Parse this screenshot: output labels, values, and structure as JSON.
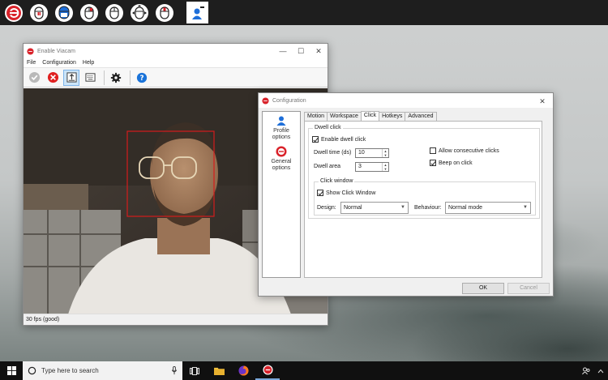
{
  "main_window": {
    "title": "Enable Viacam",
    "menu": [
      "File",
      "Configuration",
      "Help"
    ],
    "status": "30 fps (good)"
  },
  "config_window": {
    "title": "Configuration",
    "sidebar": [
      {
        "label": "Profile options",
        "line1": "Profile",
        "line2": "options"
      },
      {
        "label": "General options",
        "line1": "General",
        "line2": "options"
      }
    ],
    "tabs": [
      "Motion",
      "Workspace",
      "Click",
      "Hotkeys",
      "Advanced"
    ],
    "selected_tab": "Click",
    "dwell": {
      "group_label": "Dwell click",
      "enable_label": "Enable dwell click",
      "enable_checked": true,
      "time_label": "Dwell time (ds)",
      "time_value": "10",
      "area_label": "Dwell area",
      "area_value": "3",
      "consecutive_label": "Allow consecutive clicks",
      "consecutive_checked": false,
      "beep_label": "Beep on click",
      "beep_checked": true
    },
    "click_window": {
      "group_label": "Click window",
      "show_label": "Show Click Window",
      "show_checked": true,
      "design_label": "Design:",
      "design_value": "Normal",
      "behaviour_label": "Behaviour:",
      "behaviour_value": "Normal mode"
    },
    "ok_label": "OK",
    "cancel_label": "Cancel"
  },
  "taskbar": {
    "search_placeholder": "Type here to search"
  },
  "colors": {
    "brand_red": "#d9222a",
    "accent_blue": "#1e6fd9",
    "face_box": "#d41c1c"
  }
}
